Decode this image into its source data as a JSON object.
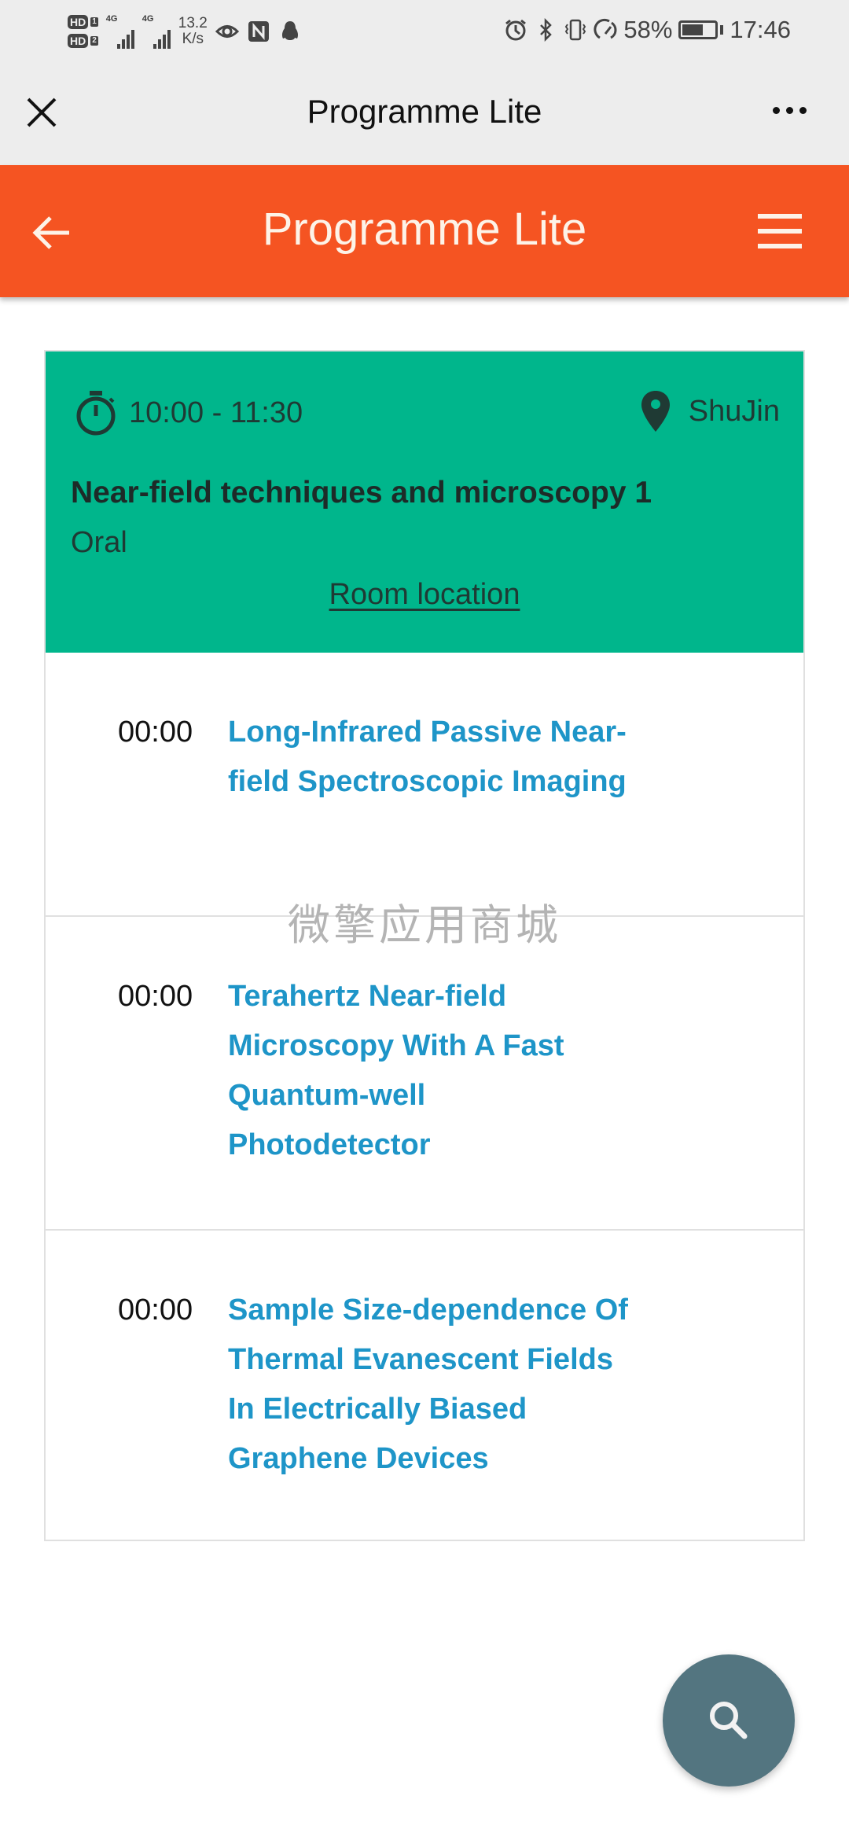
{
  "status_bar": {
    "sim1_label": "HD",
    "sim1_index": "1",
    "sim2_label": "HD",
    "sim2_index": "2",
    "network1": "4G",
    "network2": "4G",
    "speed_value": "13.2",
    "speed_unit": "K/s",
    "icons_left": [
      "eye-icon",
      "nfc-icon",
      "qq-penguin-icon"
    ],
    "icons_right": [
      "alarm-icon",
      "bluetooth-icon",
      "vibrate-icon",
      "data-saver-icon"
    ],
    "battery_percent": "58%",
    "battery_level": 0.58,
    "time": "17:46"
  },
  "top_bar": {
    "title": "Programme Lite",
    "close_icon": "close-icon",
    "more_icon": "more-dots-icon"
  },
  "app_bar": {
    "title": "Programme Lite",
    "back_icon": "arrow-left-icon",
    "menu_icon": "hamburger-menu-icon",
    "color": "#f55422"
  },
  "session": {
    "time_range": "10:00 - 11:30",
    "location": "ShuJin",
    "title": "Near-field techniques and microscopy 1",
    "type": "Oral",
    "room_link": "Room location",
    "color": "#00b68c"
  },
  "talks": [
    {
      "time": "00:00",
      "title": "Long-Infrared Passive Near-field Spectroscopic Imaging"
    },
    {
      "time": "00:00",
      "title": "Terahertz Near-field Microscopy With A Fast Quantum-well Photodetector"
    },
    {
      "time": "00:00",
      "title": "Sample Size-dependence Of Thermal Evanescent Fields In Electrically Biased Graphene Devices"
    }
  ],
  "watermark": "微擎应用商城",
  "fab": {
    "icon": "search-icon",
    "color": "#537580"
  }
}
